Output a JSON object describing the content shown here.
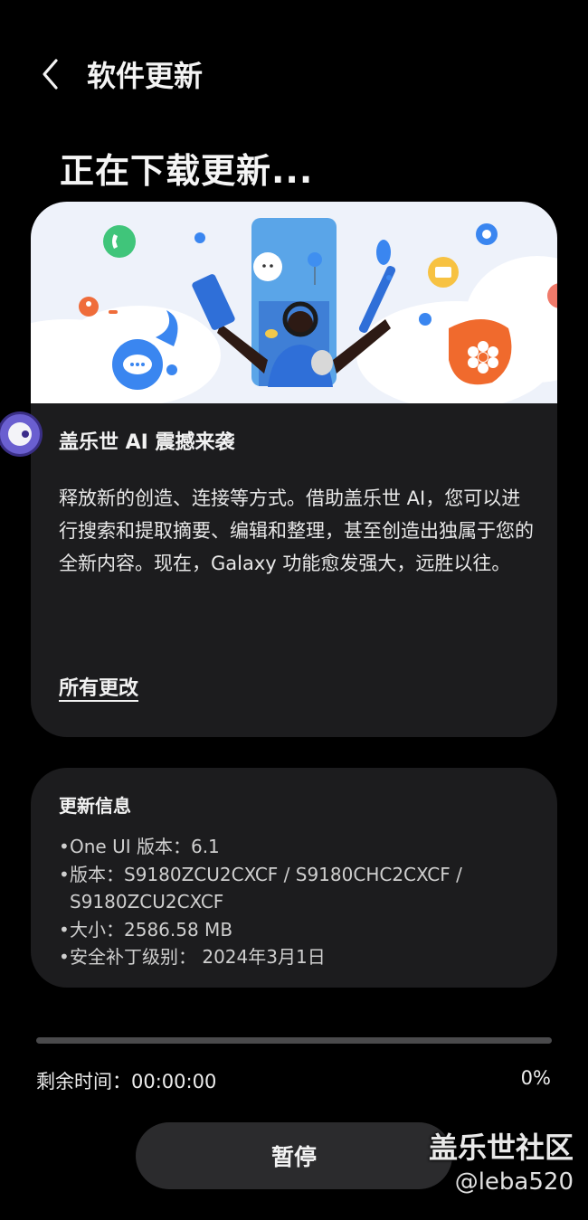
{
  "header": {
    "back_icon": "chevron-left-icon",
    "title": "软件更新"
  },
  "page_title": "正在下载更新...",
  "feature": {
    "title": "盖乐世 AI 震撼来袭",
    "body": "释放新的创造、连接等方式。借助盖乐世 AI，您可以进行搜索和提取摘要、编辑和整理，甚至创造出独属于您的全新内容。现在，Galaxy 功能愈发强大，远胜以往。",
    "link": "所有更改"
  },
  "info": {
    "title": "更新信息",
    "items": [
      "One UI 版本：6.1",
      "版本：S9180ZCU2CXCF / S9180CHC2CXCF / S9180ZCU2CXCF",
      "大小：2586.58 MB",
      "安全补丁级别： 2024年3月1日"
    ]
  },
  "download": {
    "remaining_label": "剩余时间：00:00:00",
    "percent": "0%",
    "progress_fraction": 0
  },
  "pause_label": "暂停",
  "watermark": {
    "line1": "盖乐世社区",
    "line2": "@leba520"
  },
  "colors": {
    "background": "#000000",
    "card": "#1c1c1e",
    "button": "#2b2b2d",
    "progress_track": "#4a4a4c"
  }
}
